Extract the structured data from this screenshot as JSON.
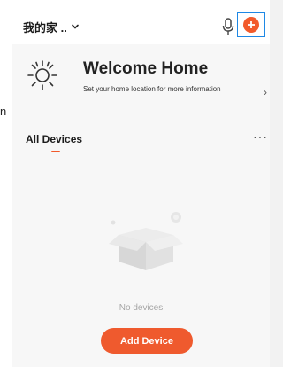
{
  "header": {
    "home_name": "我的家 ..",
    "icons": [
      "chevron-down-icon",
      "microphone-icon",
      "add-circle-icon"
    ]
  },
  "left_strip_text": "n",
  "welcome": {
    "title": "Welcome Home",
    "subtitle": "Set your home location for more information",
    "arrow": "›",
    "icon": "sun-icon"
  },
  "devices": {
    "tab_label": "All Devices",
    "more": "···",
    "empty_text": "No devices",
    "add_button_label": "Add Device"
  },
  "colors": {
    "accent": "#ef5a2e",
    "focus_outline": "#1e88e5"
  }
}
